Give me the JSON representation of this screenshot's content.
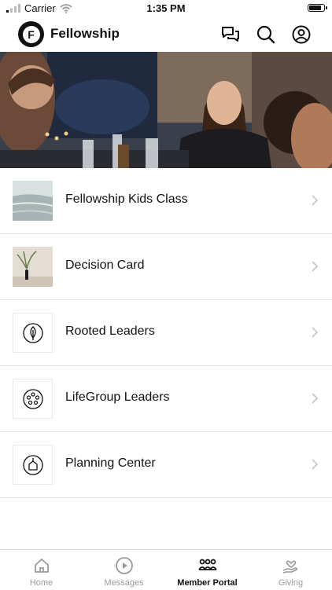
{
  "status_bar": {
    "carrier": "Carrier",
    "time": "1:35 PM",
    "battery_level": 0.9
  },
  "header": {
    "title": "Fellowship",
    "logo_letter": "F"
  },
  "menu": {
    "items": [
      {
        "label": "Fellowship Kids Class"
      },
      {
        "label": "Decision Card"
      },
      {
        "label": "Rooted Leaders"
      },
      {
        "label": "LifeGroup Leaders"
      },
      {
        "label": "Planning Center"
      }
    ]
  },
  "tabbar": {
    "tabs": [
      {
        "label": "Home"
      },
      {
        "label": "Messages"
      },
      {
        "label": "Member Portal"
      },
      {
        "label": "Giving"
      }
    ],
    "active_tab": "Member Portal"
  }
}
